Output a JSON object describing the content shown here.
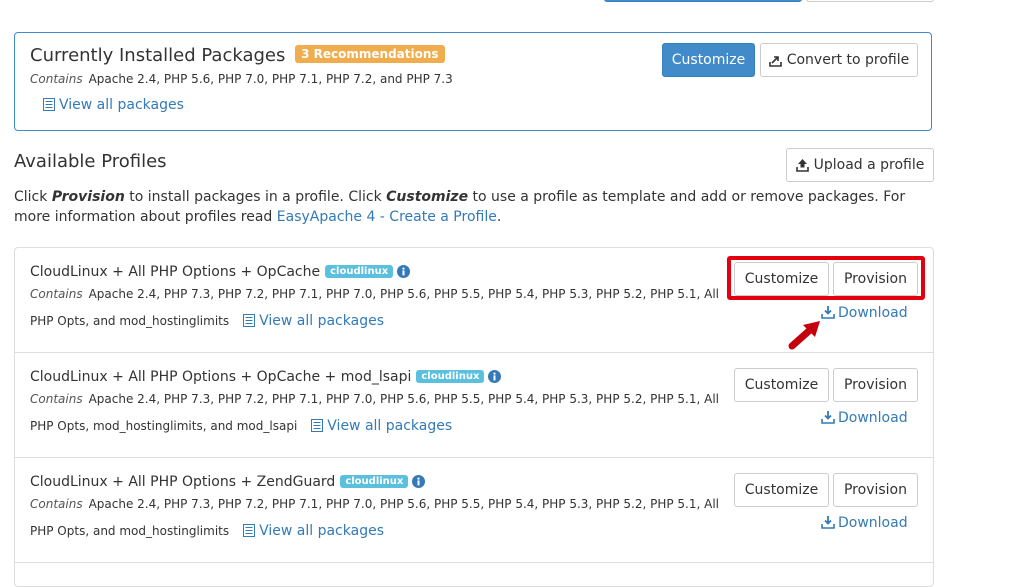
{
  "installed": {
    "title": "Currently Installed Packages",
    "badge": "3 Recommendations",
    "contains_label": "Contains",
    "contains_text": "Apache 2.4, PHP 5.6, PHP 7.0, PHP 7.1, PHP 7.2, and PHP 7.3",
    "view_all": "View all packages",
    "customize_label": "Customize",
    "convert_label": "Convert to profile"
  },
  "available": {
    "title": "Available Profiles",
    "upload_label": "Upload a profile",
    "desc_click": "Click ",
    "desc_provision": "Provision",
    "desc_mid": " to install packages in a profile. Click ",
    "desc_customize": "Customize",
    "desc_end": " to use a profile as template and add or remove packages. For more information about profiles read ",
    "desc_link": "EasyApache 4 - Create a Profile",
    "desc_period": "."
  },
  "profiles": [
    {
      "name": "CloudLinux + All PHP Options + OpCache",
      "badge": "cloudlinux",
      "contains_label": "Contains",
      "contains_line1": "Apache 2.4, PHP 7.3, PHP 7.2, PHP 7.1, PHP 7.0, PHP 5.6, PHP 5.5, PHP 5.4, PHP 5.3, PHP 5.2, PHP 5.1, All",
      "contains_line2": "PHP Opts, and mod_hostinglimits",
      "view_all": "View all packages",
      "customize_label": "Customize",
      "provision_label": "Provision",
      "download_label": "Download"
    },
    {
      "name": "CloudLinux + All PHP Options + OpCache + mod_lsapi",
      "badge": "cloudlinux",
      "contains_label": "Contains",
      "contains_line1": "Apache 2.4, PHP 7.3, PHP 7.2, PHP 7.1, PHP 7.0, PHP 5.6, PHP 5.5, PHP 5.4, PHP 5.3, PHP 5.2, PHP 5.1, All",
      "contains_line2": "PHP Opts, mod_hostinglimits, and mod_lsapi",
      "view_all": "View all packages",
      "customize_label": "Customize",
      "provision_label": "Provision",
      "download_label": "Download"
    },
    {
      "name": "CloudLinux + All PHP Options + ZendGuard",
      "badge": "cloudlinux",
      "contains_label": "Contains",
      "contains_line1": "Apache 2.4, PHP 7.3, PHP 7.2, PHP 7.1, PHP 7.0, PHP 5.6, PHP 5.5, PHP 5.4, PHP 5.3, PHP 5.2, PHP 5.1, All",
      "contains_line2": "PHP Opts, and mod_hostinglimits",
      "view_all": "View all packages",
      "customize_label": "Customize",
      "provision_label": "Provision",
      "download_label": "Download"
    }
  ],
  "icons": {
    "list": "list-icon",
    "export": "export-icon",
    "upload": "upload-icon",
    "info": "info-icon",
    "download": "download-icon",
    "arrow": "red-arrow-annotation"
  },
  "colors": {
    "primary": "#428bca",
    "link": "#337ab7",
    "warning": "#f0ad4e",
    "info": "#5bc0de",
    "highlight": "#e3000f"
  }
}
